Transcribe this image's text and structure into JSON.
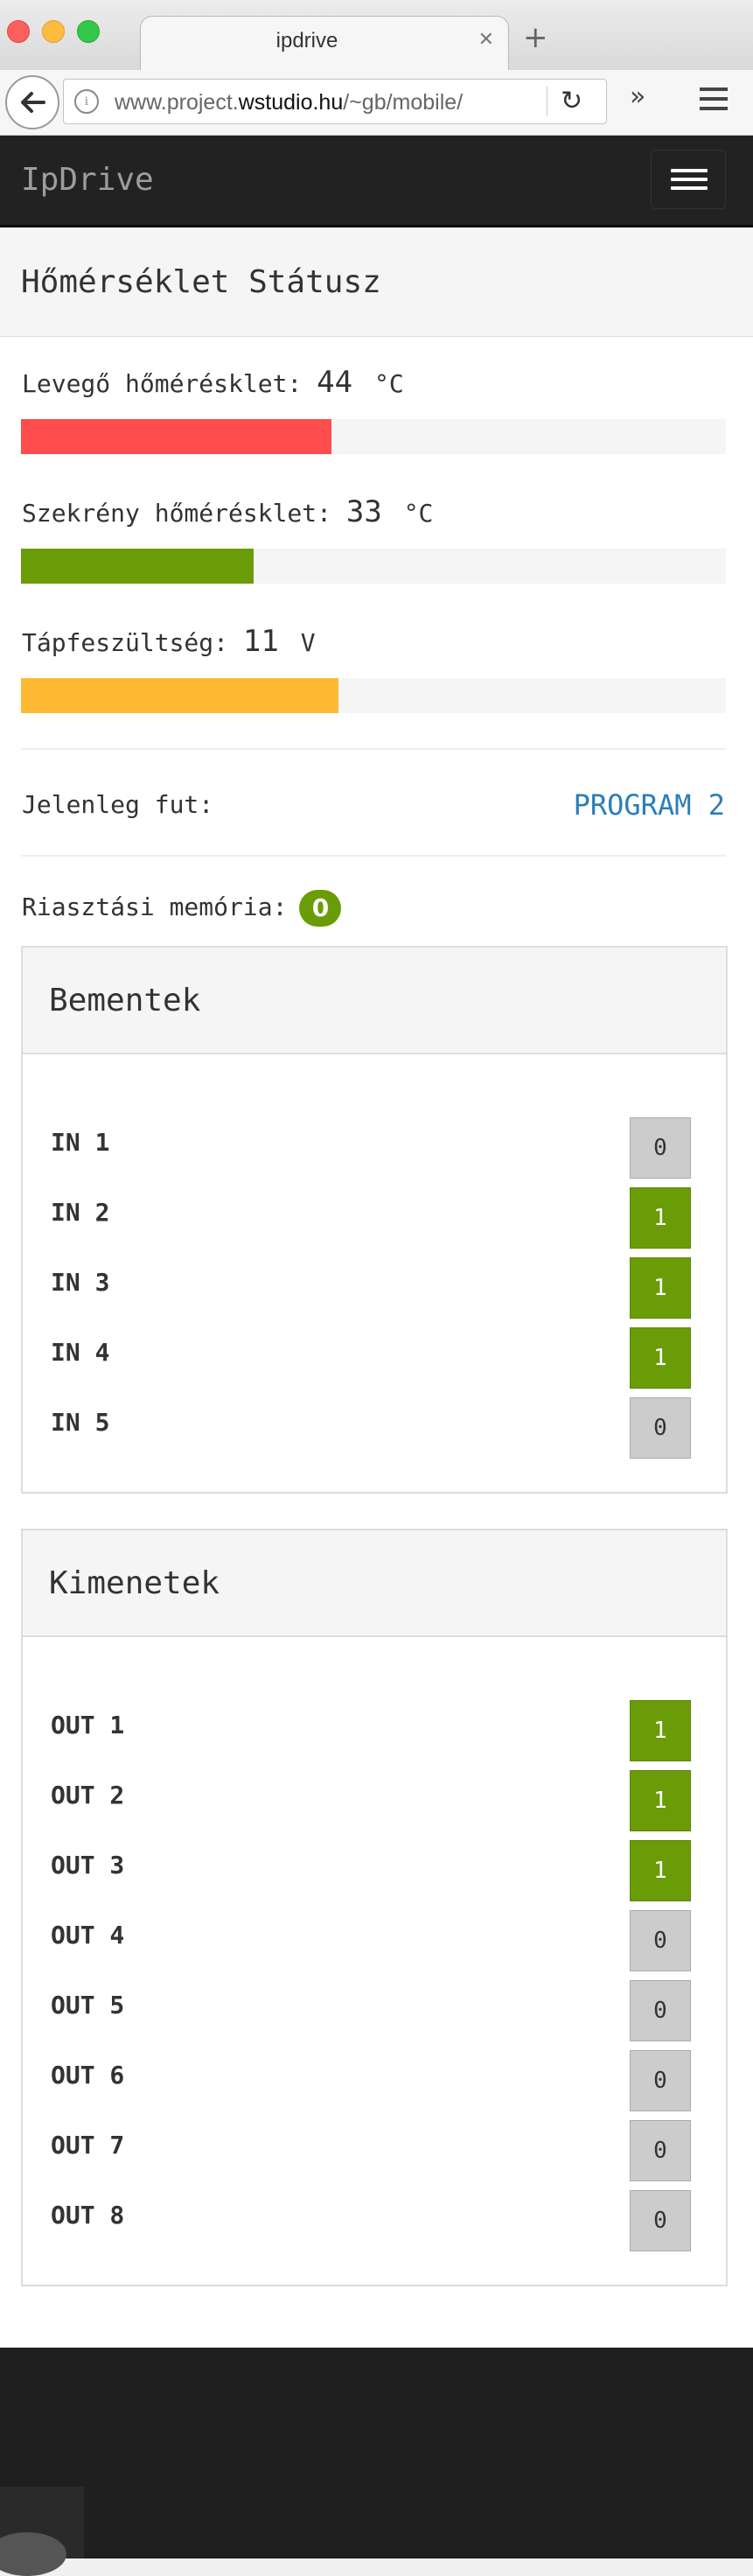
{
  "browser": {
    "tab_title": "ipdrive",
    "url_pre": "www.project.",
    "url_domain": "wstudio.hu",
    "url_post": "/~gb/mobile/"
  },
  "navbar": {
    "brand": "IpDrive"
  },
  "header": {
    "title": "Hőmérséklet Státusz"
  },
  "status": {
    "air_label": "Levegő hőmérésklet:",
    "air_value": "44",
    "air_unit": "°C",
    "air_level": 0.44,
    "air_color": "#ff4c4c",
    "cabinet_label": "Szekrény hőmérésklet:",
    "cabinet_value": "33",
    "cabinet_unit": "°C",
    "cabinet_level": 0.33,
    "cabinet_color": "#6a9c07",
    "voltage_label": "Tápfeszültség:",
    "voltage_value": "11",
    "voltage_unit": "V",
    "voltage_level": 0.45,
    "voltage_color": "#fdb934"
  },
  "program": {
    "label": "Jelenleg fut:",
    "value": "PROGRAM 2"
  },
  "alarm": {
    "label": "Riasztási memória:",
    "count": "0"
  },
  "inputs": {
    "title": "Bementek",
    "items": [
      {
        "label": "IN 1",
        "value": "0"
      },
      {
        "label": "IN 2",
        "value": "1"
      },
      {
        "label": "IN 3",
        "value": "1"
      },
      {
        "label": "IN 4",
        "value": "1"
      },
      {
        "label": "IN 5",
        "value": "0"
      }
    ]
  },
  "outputs": {
    "title": "Kimenetek",
    "items": [
      {
        "label": "OUT 1",
        "value": "1"
      },
      {
        "label": "OUT 2",
        "value": "1"
      },
      {
        "label": "OUT 3",
        "value": "1"
      },
      {
        "label": "OUT 4",
        "value": "0"
      },
      {
        "label": "OUT 5",
        "value": "0"
      },
      {
        "label": "OUT 6",
        "value": "0"
      },
      {
        "label": "OUT 7",
        "value": "0"
      },
      {
        "label": "OUT 8",
        "value": "0"
      }
    ]
  }
}
